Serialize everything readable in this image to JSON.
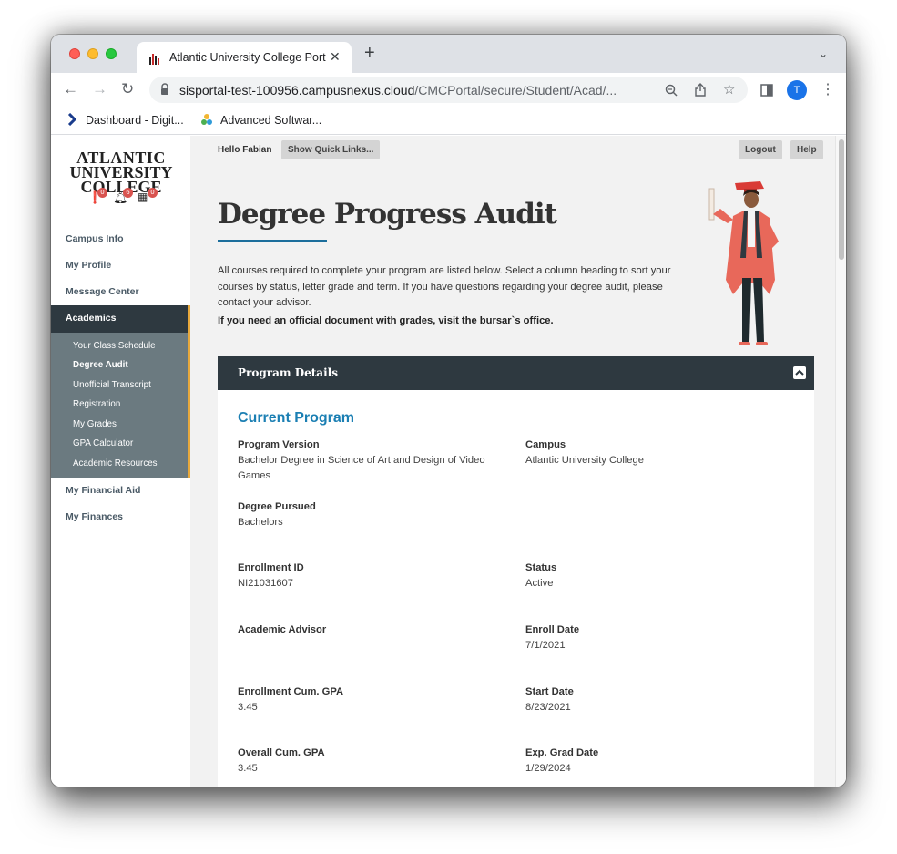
{
  "browser": {
    "tab_title": "Atlantic University College Port",
    "url_host": "sisportal-test-100956.campusnexus.cloud",
    "url_path": "/CMCPortal/secure/Student/Acad/...",
    "profile_initial": "T",
    "bookmarks": [
      {
        "label": "Dashboard - Digit..."
      },
      {
        "label": "Advanced Softwar..."
      }
    ]
  },
  "logo": {
    "line1": "ATLANTIC",
    "line2": "UNIVERSITY",
    "line3": "COLLEGE"
  },
  "badges": [
    {
      "icon": "alert-icon",
      "count": "0"
    },
    {
      "icon": "bell-icon",
      "count": "6"
    },
    {
      "icon": "calendar-icon",
      "count": "0"
    }
  ],
  "sidebar": {
    "items": [
      {
        "label": "Campus Info"
      },
      {
        "label": "My Profile"
      },
      {
        "label": "Message Center"
      },
      {
        "label": "Academics"
      },
      {
        "label": "My Financial Aid"
      },
      {
        "label": "My Finances"
      }
    ],
    "academics_sub": [
      {
        "label": "Your Class Schedule"
      },
      {
        "label": "Degree Audit"
      },
      {
        "label": "Unofficial Transcript"
      },
      {
        "label": "Registration"
      },
      {
        "label": "My Grades"
      },
      {
        "label": "GPA Calculator"
      },
      {
        "label": "Academic Resources"
      }
    ]
  },
  "header": {
    "hello": "Hello Fabian",
    "quick_links": "Show Quick Links...",
    "logout": "Logout",
    "help": "Help"
  },
  "page": {
    "title": "Degree Progress Audit",
    "intro": "All courses required to complete your program are listed below. Select a column heading to sort your courses by status, letter grade and term. If you have questions regarding your degree audit, please contact your advisor.",
    "intro_bold": "If you need an official document with grades, visit the bursar`s office."
  },
  "panel": {
    "title": "Program Details",
    "section_title": "Current Program",
    "fields": {
      "program_version": {
        "label": "Program Version",
        "value": "Bachelor Degree in Science of Art and Design of Video Games"
      },
      "campus": {
        "label": "Campus",
        "value": "Atlantic University College"
      },
      "degree_pursued": {
        "label": "Degree Pursued",
        "value": "Bachelors"
      },
      "enrollment_id": {
        "label": "Enrollment ID",
        "value": "NI21031607"
      },
      "status": {
        "label": "Status",
        "value": "Active"
      },
      "academic_advisor": {
        "label": "Academic Advisor",
        "value": ""
      },
      "enroll_date": {
        "label": "Enroll Date",
        "value": "7/1/2021"
      },
      "enrollment_gpa": {
        "label": "Enrollment Cum. GPA",
        "value": "3.45"
      },
      "start_date": {
        "label": "Start Date",
        "value": "8/23/2021"
      },
      "overall_gpa": {
        "label": "Overall Cum. GPA",
        "value": "3.45"
      },
      "exp_grad_date": {
        "label": "Exp. Grad Date",
        "value": "1/29/2024"
      }
    }
  }
}
